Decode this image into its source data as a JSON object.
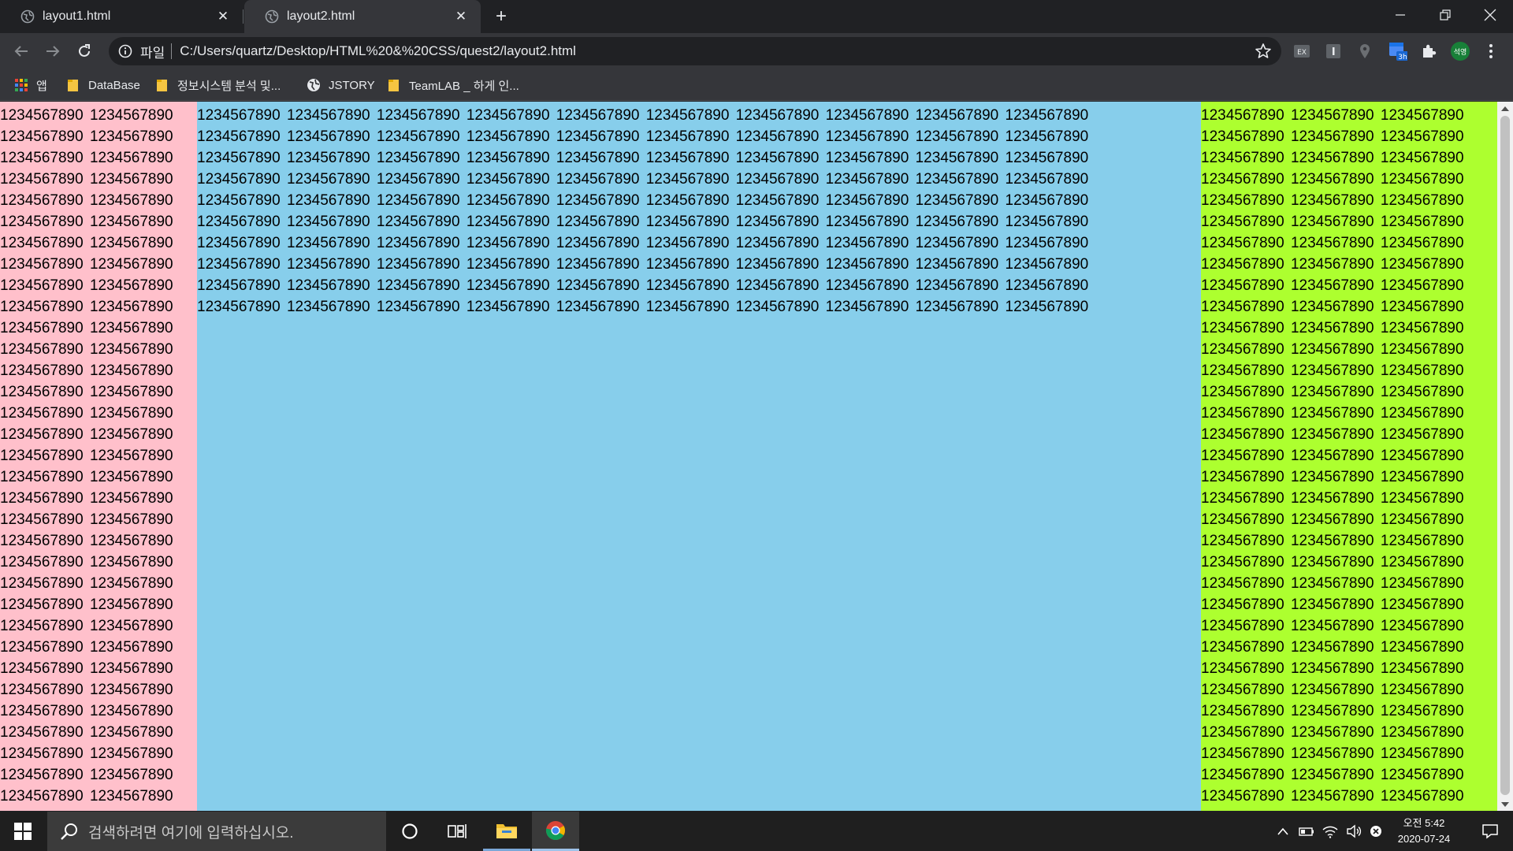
{
  "browser": {
    "tabs": [
      {
        "title": "layout1.html",
        "active": false
      },
      {
        "title": "layout2.html",
        "active": true
      }
    ],
    "address": {
      "scheme_label": "파일",
      "url": "C:/Users/quartz/Desktop/HTML%20&%20CSS/quest2/layout2.html"
    },
    "bookmarks": [
      {
        "label": "앱",
        "icon": "apps-grid-icon"
      },
      {
        "label": "DataBase",
        "icon": "folder-icon"
      },
      {
        "label": "정보시스템 분석 및...",
        "icon": "folder-icon"
      },
      {
        "label": "JSTORY",
        "icon": "globe-icon"
      },
      {
        "label": "TeamLAB _ 하게 인...",
        "icon": "folder-icon"
      }
    ],
    "profile_label": "석영"
  },
  "page": {
    "token": "1234567890",
    "colors": {
      "left": "#ffc0cb",
      "middle": "#87ceeb",
      "right": "#adff2f"
    },
    "left_column": {
      "tokens_per_line": 2,
      "lines": 33
    },
    "middle_column": {
      "tokens_per_line": 10,
      "lines": 10
    },
    "right_column": {
      "tokens_per_line": 3,
      "lines": 33
    }
  },
  "taskbar": {
    "search_placeholder": "검색하려면 여기에 입력하십시오.",
    "time": "오전 5:42",
    "date": "2020-07-24"
  }
}
